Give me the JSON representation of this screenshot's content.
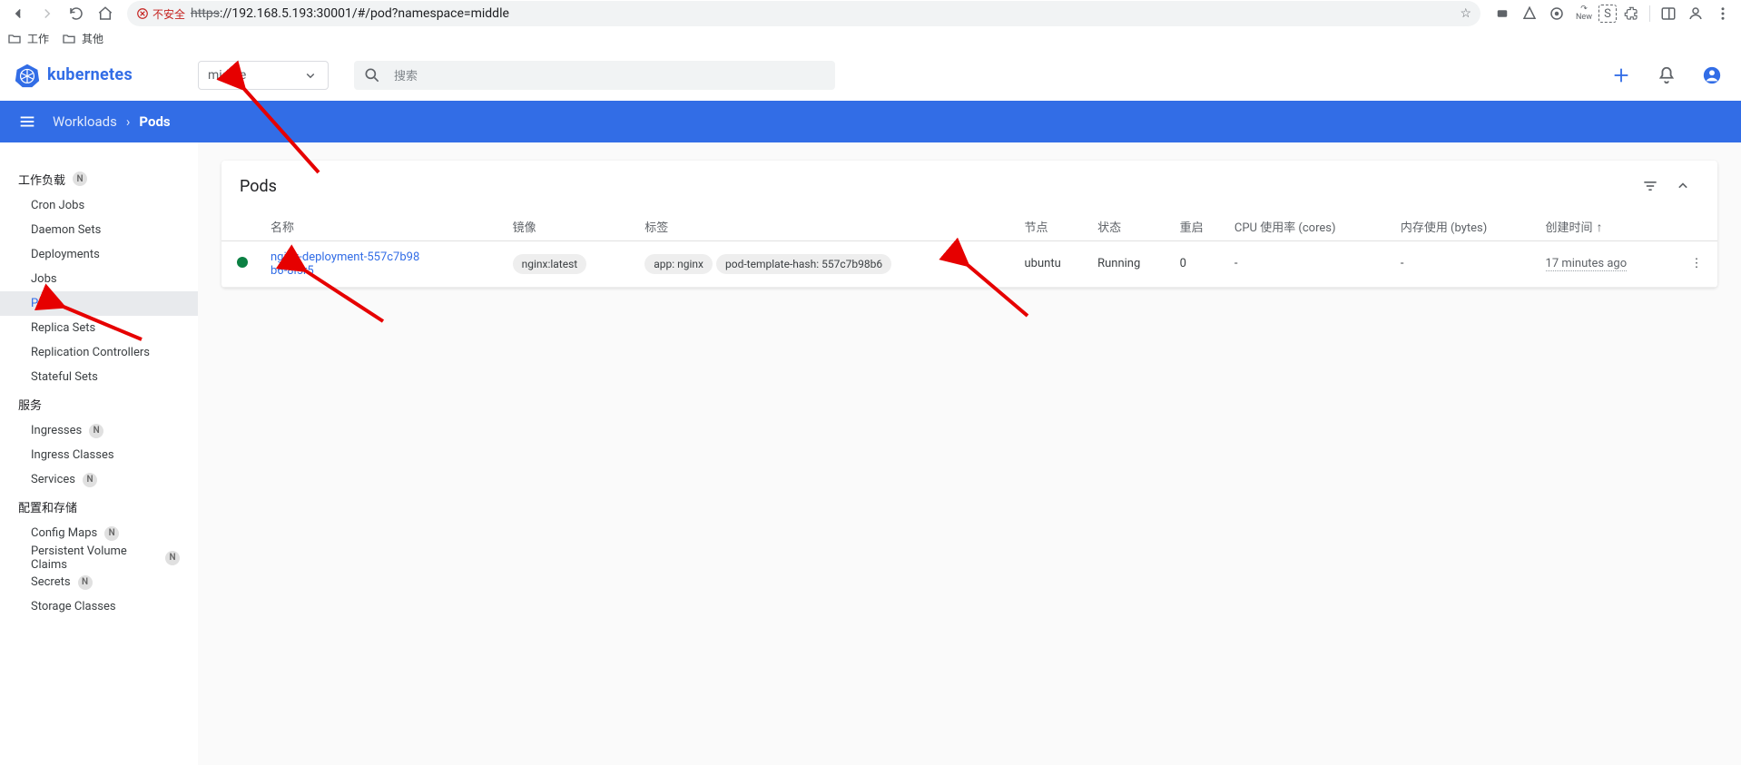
{
  "browser": {
    "insecure_label": "不安全",
    "url_strike": "https",
    "url_rest": "://192.168.5.193:30001/#/pod?namespace=middle",
    "bookmarks": [
      {
        "label": "工作"
      },
      {
        "label": "其他"
      }
    ]
  },
  "header": {
    "brand": "kubernetes",
    "namespace": "middle",
    "search_placeholder": "搜索"
  },
  "breadcrumb": {
    "workloads": "Workloads",
    "current": "Pods"
  },
  "sidebar": {
    "groups": [
      {
        "title": "工作负载",
        "badge": "N",
        "items": [
          {
            "label": "Cron Jobs"
          },
          {
            "label": "Daemon Sets"
          },
          {
            "label": "Deployments"
          },
          {
            "label": "Jobs"
          },
          {
            "label": "Pods",
            "active": true
          },
          {
            "label": "Replica Sets"
          },
          {
            "label": "Replication Controllers"
          },
          {
            "label": "Stateful Sets"
          }
        ]
      },
      {
        "title": "服务",
        "items": [
          {
            "label": "Ingresses",
            "badge": "N"
          },
          {
            "label": "Ingress Classes"
          },
          {
            "label": "Services",
            "badge": "N"
          }
        ]
      },
      {
        "title": "配置和存储",
        "items": [
          {
            "label": "Config Maps",
            "badge": "N"
          },
          {
            "label": "Persistent Volume Claims",
            "badge": "N"
          },
          {
            "label": "Secrets",
            "badge": "N"
          },
          {
            "label": "Storage Classes"
          }
        ]
      }
    ]
  },
  "pods": {
    "title": "Pods",
    "columns": {
      "name": "名称",
      "image": "镜像",
      "labels": "标签",
      "node": "节点",
      "status": "状态",
      "restarts": "重启",
      "cpu": "CPU 使用率 (cores)",
      "memory": "内存使用 (bytes)",
      "created": "创建时间"
    },
    "rows": [
      {
        "name": "nginx-deployment-557c7b98b6-8l5r5",
        "image": "nginx:latest",
        "labels": [
          "app: nginx",
          "pod-template-hash: 557c7b98b6"
        ],
        "node": "ubuntu",
        "status": "Running",
        "status_color": "#0b8043",
        "restarts": "0",
        "cpu": "-",
        "memory": "-",
        "created": "17 minutes ago"
      }
    ]
  }
}
